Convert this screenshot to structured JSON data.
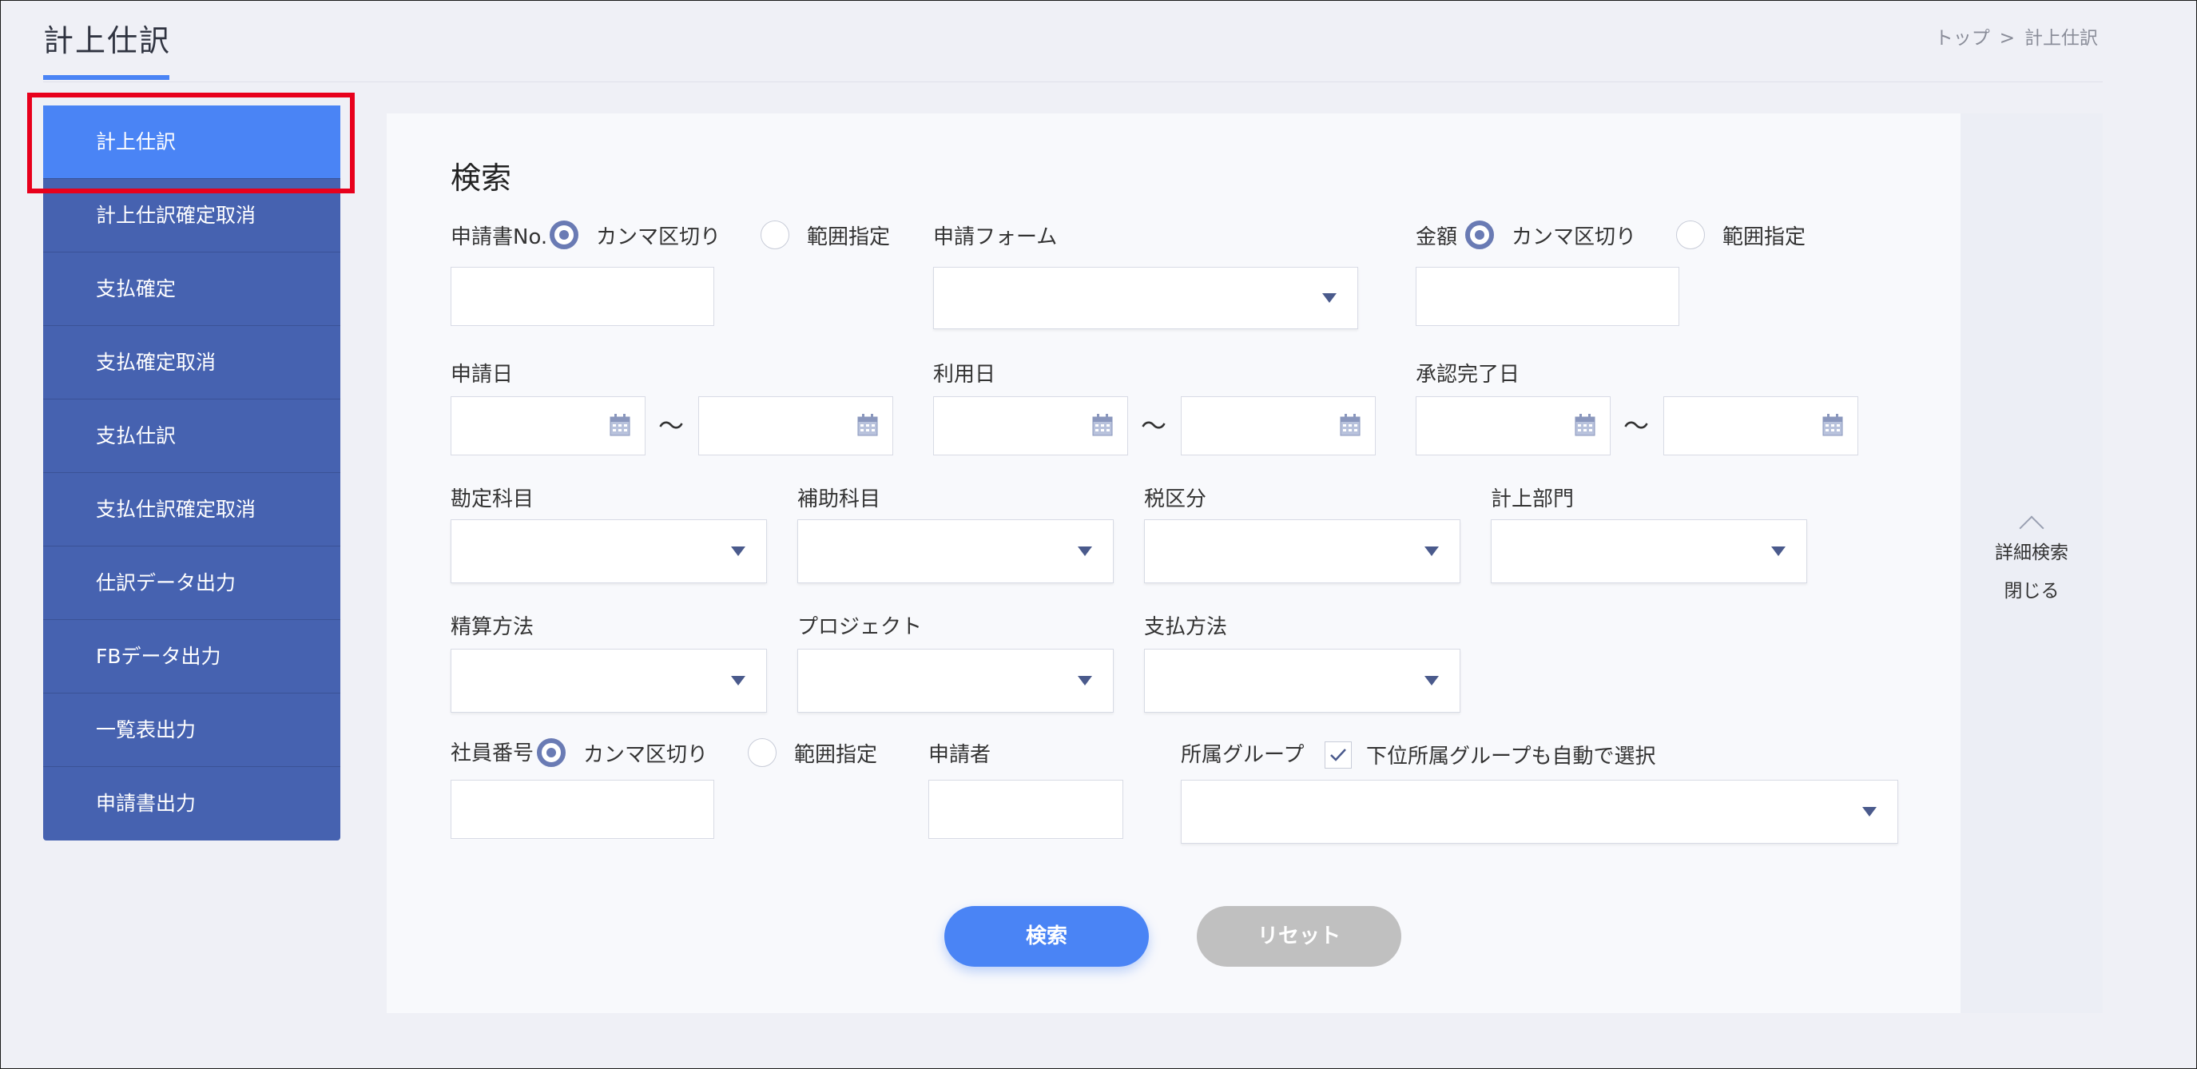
{
  "header": {
    "title": "計上仕訳",
    "breadcrumb": {
      "home": "トップ",
      "sep": ">",
      "current": "計上仕訳"
    }
  },
  "sidebar": {
    "items": [
      {
        "label": "計上仕訳"
      },
      {
        "label": "計上仕訳確定取消"
      },
      {
        "label": "支払確定"
      },
      {
        "label": "支払確定取消"
      },
      {
        "label": "支払仕訳"
      },
      {
        "label": "支払仕訳確定取消"
      },
      {
        "label": "仕訳データ出力"
      },
      {
        "label": "FBデータ出力"
      },
      {
        "label": "一覧表出力"
      },
      {
        "label": "申請書出力"
      }
    ],
    "active_index": 0
  },
  "search": {
    "title": "検索",
    "application_no": {
      "label": "申請書No.",
      "opt_comma": "カンマ区切り",
      "opt_range": "範囲指定",
      "selected": "カンマ区切り"
    },
    "application_form": {
      "label": "申請フォーム"
    },
    "amount": {
      "label": "金額",
      "opt_comma": "カンマ区切り",
      "opt_range": "範囲指定",
      "selected": "カンマ区切り"
    },
    "application_date": {
      "label": "申請日",
      "sep": "〜"
    },
    "usage_date": {
      "label": "利用日",
      "sep": "〜"
    },
    "approval_date": {
      "label": "承認完了日",
      "sep": "〜"
    },
    "account": {
      "label": "勘定科目"
    },
    "sub_account": {
      "label": "補助科目"
    },
    "tax_category": {
      "label": "税区分"
    },
    "department": {
      "label": "計上部門"
    },
    "settlement_method": {
      "label": "精算方法"
    },
    "project": {
      "label": "プロジェクト"
    },
    "payment_method": {
      "label": "支払方法"
    },
    "employee_no": {
      "label": "社員番号",
      "opt_comma": "カンマ区切り",
      "opt_range": "範囲指定",
      "selected": "カンマ区切り"
    },
    "applicant": {
      "label": "申請者"
    },
    "group": {
      "label": "所属グループ",
      "checkbox_label": "下位所属グループも自動で選択",
      "checked": true
    },
    "buttons": {
      "search": "検索",
      "reset": "リセット"
    }
  },
  "collapse": {
    "line1": "詳細検索",
    "line2": "閉じる"
  },
  "colors": {
    "accent": "#4a84f5",
    "sidebar": "#4662b0",
    "highlight": "#e8001c",
    "reset": "#c0c0c0"
  }
}
